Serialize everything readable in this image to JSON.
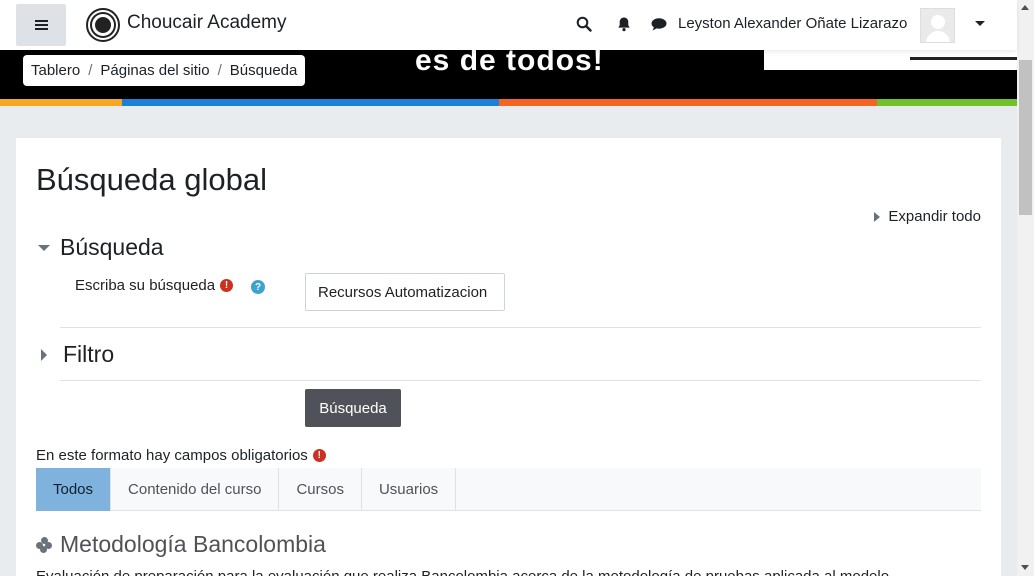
{
  "navbar": {
    "site_name": "Choucair Academy",
    "user_name": "Leyston Alexander Oñate Lizarazo",
    "icons": [
      "menu-icon",
      "search-icon",
      "bell-icon",
      "chat-icon",
      "chevron-down-icon"
    ]
  },
  "banner": {
    "text": "es de todos!",
    "stripe_colors": [
      "#f7a823",
      "#1a80d8",
      "#f26522",
      "#72c02c"
    ]
  },
  "breadcrumb": {
    "items": [
      "Tablero",
      "Páginas del sitio",
      "Búsqueda"
    ],
    "separator": "/"
  },
  "main": {
    "title": "Búsqueda global",
    "expand_all": "Expandir todo",
    "section_search": "Búsqueda",
    "field_label": "Escriba su búsqueda",
    "search_value": "Recursos Automatizacion",
    "section_filter": "Filtro",
    "submit_label": "Búsqueda",
    "required_note": "En este formato hay campos obligatorios",
    "tabs": [
      {
        "label": "Todos",
        "active": true
      },
      {
        "label": "Contenido del curso",
        "active": false
      },
      {
        "label": "Cursos",
        "active": false
      },
      {
        "label": "Usuarios",
        "active": false
      }
    ],
    "result": {
      "title": "Metodología Bancolombia",
      "description": "Evaluación de preparación para la evaluación que realiza Bancolombia acerca de la metodología de pruebas aplicada al modelo"
    }
  },
  "colors": {
    "active_tab": "#7fb2dd",
    "button": "#4f5258",
    "required": "#ca3120",
    "help": "#3ea2cf"
  }
}
